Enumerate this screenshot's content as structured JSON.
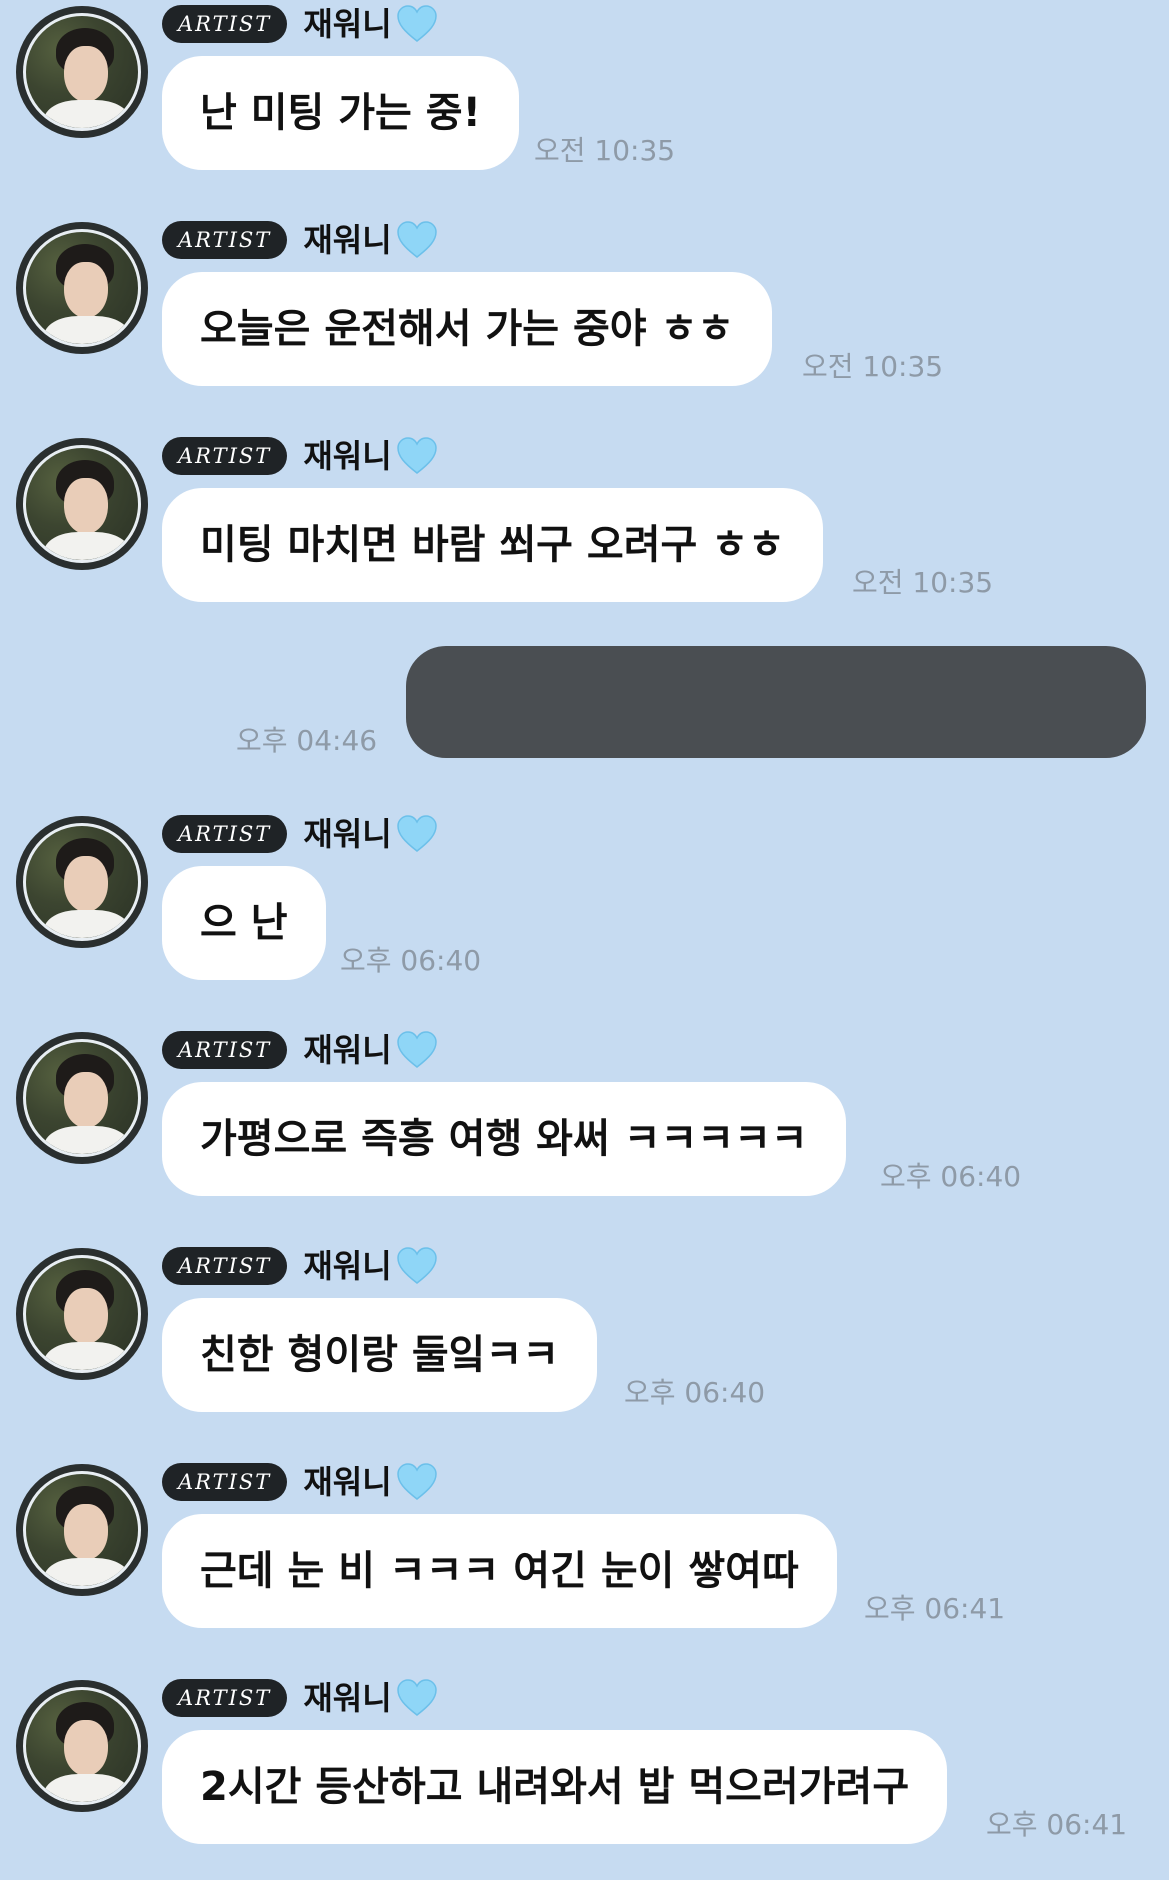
{
  "badge_label": "ARTIST",
  "sender_name": "재워니",
  "colors": {
    "background": "#c6dbf1",
    "received_bubble": "#ffffff",
    "sent_bubble": "#4a4e52",
    "timestamp": "#8e9aa7",
    "badge": "#1f2326",
    "heart": "#8fd6f7"
  },
  "messages": [
    {
      "text": "난 미팅 가는 중!",
      "time": "오전 10:35"
    },
    {
      "text": "오늘은 운전해서 가는 중야 ㅎㅎ",
      "time": "오전 10:35"
    },
    {
      "text": "미팅 마치면 바람 쐬구 오려구 ㅎㅎ",
      "time": "오전 10:35"
    },
    {
      "text": "으 난",
      "time": "오후 06:40"
    },
    {
      "text": "가평으로 즉흥 여행 와써 ㅋㅋㅋㅋㅋ",
      "time": "오후 06:40"
    },
    {
      "text": "친한 형이랑 둘잌ㅋㅋ",
      "time": "오후 06:40"
    },
    {
      "text": "근데 눈 비 ㅋㅋㅋ 여긴 눈이 쌓여따",
      "time": "오후 06:41"
    },
    {
      "text": "2시간 등산하고 내려와서 밥 먹으러가려구",
      "time": "오후 06:41"
    }
  ],
  "sent_message": {
    "time": "오후 04:46"
  }
}
